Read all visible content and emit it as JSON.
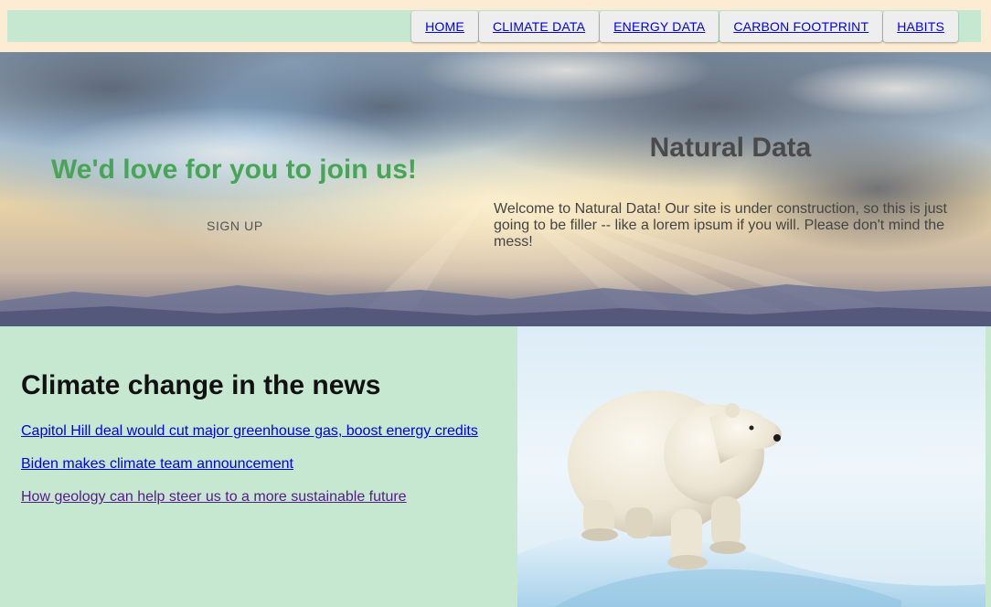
{
  "nav": {
    "items": [
      {
        "label": "HOME"
      },
      {
        "label": "CLIMATE DATA"
      },
      {
        "label": "ENERGY DATA"
      },
      {
        "label": "CARBON FOOTPRINT"
      },
      {
        "label": "HABITS"
      }
    ]
  },
  "hero": {
    "join_title": "We'd love for you to join us!",
    "signup_label": "SIGN UP",
    "site_title": "Natural Data",
    "welcome_text": "Welcome to Natural Data! Our site is under construction, so this is just going to be filler -- like a lorem ipsum if you will. Please don't mind the mess!"
  },
  "news": {
    "title": "Climate change in the news",
    "links": [
      {
        "label": "Capitol Hill deal would cut major greenhouse gas, boost energy credits"
      },
      {
        "label": "Biden makes climate team announcement"
      },
      {
        "label": "How geology can help steer us to a more sustainable future"
      }
    ]
  },
  "colors": {
    "nav_background": "#c6e8d0",
    "page_frame": "#fdebd3",
    "join_title": "#46a655",
    "link": "#0000ee",
    "visited_link": "#551a8b"
  }
}
